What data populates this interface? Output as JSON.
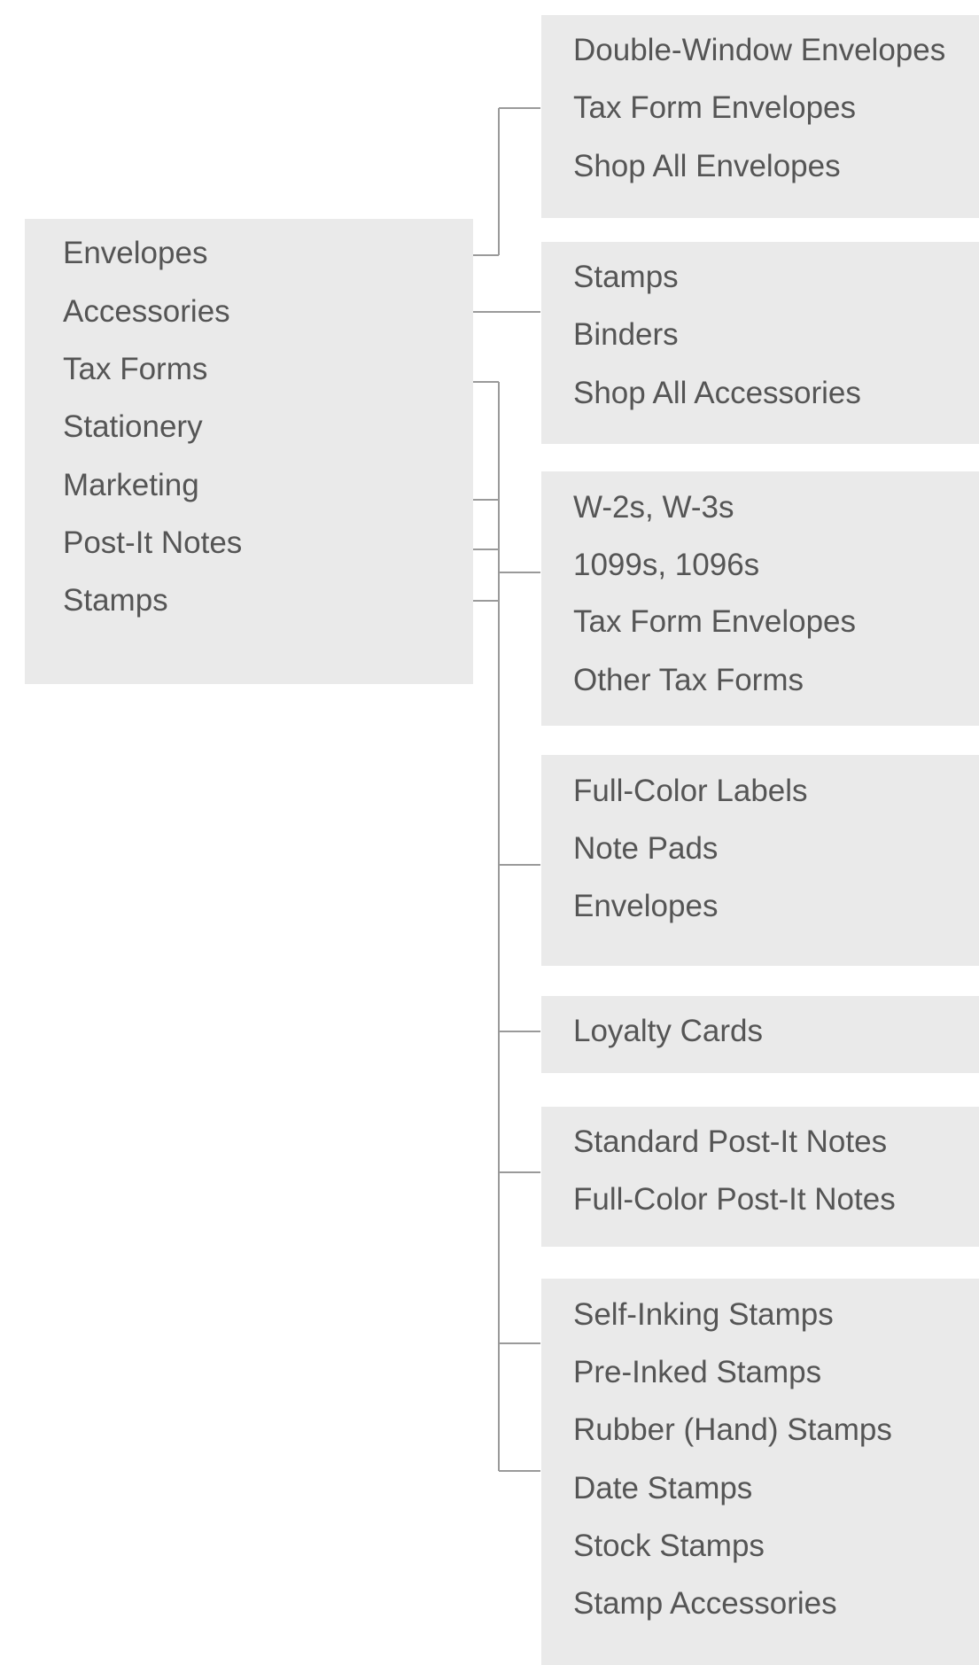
{
  "main_menu": {
    "items": [
      "Envelopes",
      "Accessories",
      "Tax Forms",
      "Stationery",
      "Marketing",
      "Post-It Notes",
      "Stamps"
    ]
  },
  "submenus": [
    {
      "items": [
        "Double-Window Envelopes",
        "Tax Form Envelopes",
        "Shop All Envelopes"
      ]
    },
    {
      "items": [
        "Stamps",
        "Binders",
        "Shop All Accessories"
      ]
    },
    {
      "items": [
        "W-2s, W-3s",
        "1099s, 1096s",
        "Tax Form Envelopes",
        "Other Tax Forms"
      ]
    },
    {
      "items": [
        "Full-Color Labels",
        "Note Pads",
        "Envelopes"
      ]
    },
    {
      "items": [
        "Loyalty Cards"
      ]
    },
    {
      "items": [
        "Standard Post-It Notes",
        "Full-Color Post-It Notes"
      ]
    },
    {
      "items": [
        "Self-Inking Stamps",
        "Pre-Inked Stamps",
        "Rubber (Hand) Stamps",
        "Date Stamps",
        "Stock Stamps",
        "Stamp Accessories"
      ]
    }
  ],
  "colors": {
    "panel_bg": "#eaeaea",
    "text": "#555555",
    "connector": "#9a9a9a"
  }
}
